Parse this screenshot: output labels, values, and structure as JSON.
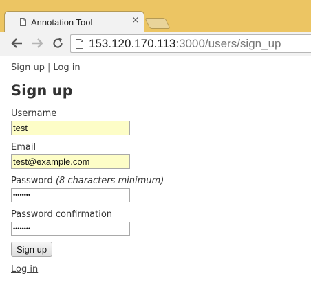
{
  "browser": {
    "tab_title": "Annotation Tool",
    "tab_close": "×",
    "url_host": "153.120.170.113",
    "url_rest": ":3000/users/sign_up"
  },
  "nav": {
    "sign_up": "Sign up",
    "separator": "|",
    "log_in": "Log in"
  },
  "page_title": "Sign up",
  "form": {
    "username": {
      "label": "Username",
      "value": "test"
    },
    "email": {
      "label": "Email",
      "value": "test@example.com"
    },
    "password": {
      "label": "Password",
      "hint": "(8 characters minimum)",
      "value": "••••••••"
    },
    "password_confirmation": {
      "label": "Password confirmation",
      "value": "••••••••"
    },
    "submit_label": "Sign up"
  },
  "footer_link": "Log in",
  "colors": {
    "tabstrip": "#ecc563",
    "autofill": "#fdfdc7",
    "text": "#333333"
  }
}
